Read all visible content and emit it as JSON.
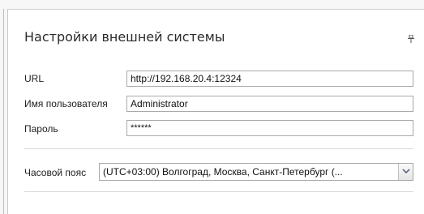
{
  "panel": {
    "title": "Настройки внешней системы",
    "pin_icon": "pin-icon"
  },
  "connection": {
    "url_label": "URL",
    "url_value": "http://192.168.20.4:12324",
    "username_label": "Имя пользователя",
    "username_value": "Administrator",
    "password_label": "Пароль",
    "password_value": "******"
  },
  "timezone": {
    "label": "Часовой пояс",
    "selected": "(UTC+03:00) Волгоград, Москва, Санкт-Петербург (...",
    "dropdown_icon": "chevron-down-icon"
  },
  "colors": {
    "border": "#a9a9a9",
    "divider": "#d9d9d9",
    "title_text": "#2b2b2b"
  }
}
